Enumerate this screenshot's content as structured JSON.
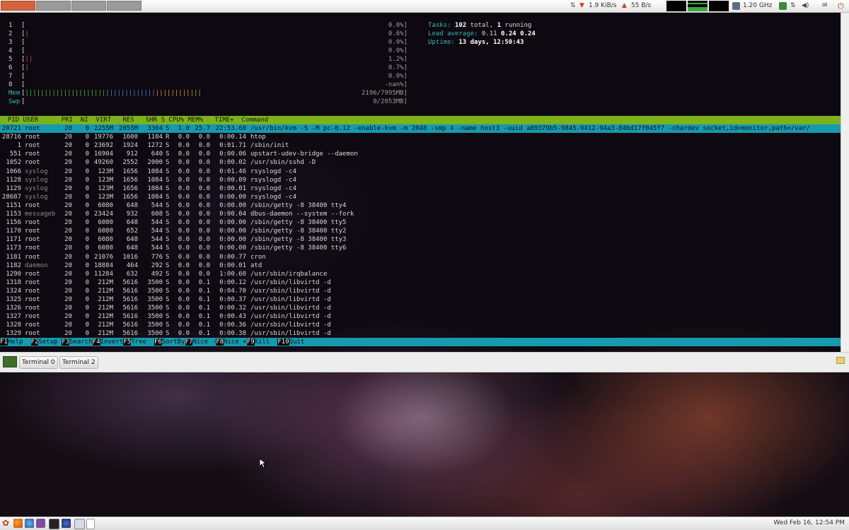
{
  "top_panel": {
    "net_down": "1.9 KiB/s",
    "net_up": "55 B/s",
    "cpu_freq": "1.20 GHz",
    "icons": [
      "network-arrows-icon",
      "download-arrow-icon",
      "upload-arrow-icon",
      "cpu-freq-icon",
      "update-icon",
      "network-icon",
      "volume-icon",
      "mail-icon",
      "power-icon"
    ]
  },
  "htop": {
    "cpus": [
      {
        "label": "1",
        "bar": "",
        "value": "0.0%]"
      },
      {
        "label": "2",
        "bar": "|",
        "value": "0.6%]"
      },
      {
        "label": "3",
        "bar": "",
        "value": "0.0%]"
      },
      {
        "label": "4",
        "bar": "",
        "value": "0.0%]"
      },
      {
        "label": "5",
        "bar": "||",
        "value": "1.2%]"
      },
      {
        "label": "6",
        "bar": "|",
        "value": "0.7%]"
      },
      {
        "label": "7",
        "bar": "",
        "value": "0.0%]"
      },
      {
        "label": "8",
        "bar": "",
        "value": "-nan%]"
      }
    ],
    "mem": {
      "label": "Mem",
      "value": "2196/7995MB]"
    },
    "swp": {
      "label": "Swp",
      "value": "0/2053MB]"
    },
    "tasks_label": "Tasks:",
    "tasks_total": "102",
    "tasks_total_word": "total,",
    "tasks_running": "1",
    "tasks_running_word": "running",
    "load_label": "Load average:",
    "load_1": "0.11",
    "load_5": "0.24",
    "load_15": "0.24",
    "uptime_label": "Uptime:",
    "uptime_value": "13 days, 12:50:43",
    "header": "  PID USER      PRI  NI  VIRT   RES   SHR S CPU% MEM%   TIME+  Command",
    "processes": [
      {
        "pid": "20721",
        "user": "root",
        "pri": "20",
        "ni": "0",
        "virt": "2255M",
        "res": "2055M",
        "shr": "3304",
        "s": "S",
        "cpu": "1.0",
        "mem": "25.7",
        "time": "22:53.68",
        "cmd": "/usr/bin/kvm -S -M pc-0.12 -enable-kvm -m 2048 -smp 4 -name host3 -uuid a89379b5-9845-9412-94a3-846d17f045f7 -chardev socket,id=monitor,path=/var/"
      },
      {
        "pid": "28716",
        "user": "root",
        "pri": "20",
        "ni": "0",
        "virt": "19776",
        "res": "1600",
        "shr": "1104",
        "s": "R",
        "cpu": "0.0",
        "mem": "0.0",
        "time": "0:00.14",
        "cmd": "htop"
      },
      {
        "pid": "1",
        "user": "root",
        "pri": "20",
        "ni": "0",
        "virt": "23692",
        "res": "1924",
        "shr": "1272",
        "s": "S",
        "cpu": "0.0",
        "mem": "0.0",
        "time": "0:01.71",
        "cmd": "/sbin/init"
      },
      {
        "pid": "551",
        "user": "root",
        "pri": "20",
        "ni": "0",
        "virt": "16904",
        "res": "912",
        "shr": "640",
        "s": "S",
        "cpu": "0.0",
        "mem": "0.0",
        "time": "0:00.06",
        "cmd": "upstart-udev-bridge --daemon"
      },
      {
        "pid": "1052",
        "user": "root",
        "pri": "20",
        "ni": "0",
        "virt": "49260",
        "res": "2552",
        "shr": "2000",
        "s": "S",
        "cpu": "0.0",
        "mem": "0.0",
        "time": "0:00.02",
        "cmd": "/usr/sbin/sshd -D"
      },
      {
        "pid": "1066",
        "user": "syslog",
        "pri": "20",
        "ni": "0",
        "virt": "123M",
        "res": "1656",
        "shr": "1084",
        "s": "S",
        "cpu": "0.0",
        "mem": "0.0",
        "time": "0:01.46",
        "cmd": "rsyslogd -c4"
      },
      {
        "pid": "1128",
        "user": "syslog",
        "pri": "20",
        "ni": "0",
        "virt": "123M",
        "res": "1656",
        "shr": "1084",
        "s": "S",
        "cpu": "0.0",
        "mem": "0.0",
        "time": "0:00.09",
        "cmd": "rsyslogd -c4"
      },
      {
        "pid": "1129",
        "user": "syslog",
        "pri": "20",
        "ni": "0",
        "virt": "123M",
        "res": "1656",
        "shr": "1084",
        "s": "S",
        "cpu": "0.0",
        "mem": "0.0",
        "time": "0:00.01",
        "cmd": "rsyslogd -c4"
      },
      {
        "pid": "28687",
        "user": "syslog",
        "pri": "20",
        "ni": "0",
        "virt": "123M",
        "res": "1656",
        "shr": "1084",
        "s": "S",
        "cpu": "0.0",
        "mem": "0.0",
        "time": "0:00.00",
        "cmd": "rsyslogd -c4"
      },
      {
        "pid": "1151",
        "user": "root",
        "pri": "20",
        "ni": "0",
        "virt": "6080",
        "res": "648",
        "shr": "544",
        "s": "S",
        "cpu": "0.0",
        "mem": "0.0",
        "time": "0:00.00",
        "cmd": "/sbin/getty -8 38400 tty4"
      },
      {
        "pid": "1153",
        "user": "messageb",
        "pri": "20",
        "ni": "0",
        "virt": "23424",
        "res": "932",
        "shr": "608",
        "s": "S",
        "cpu": "0.0",
        "mem": "0.0",
        "time": "0:00.04",
        "cmd": "dbus-daemon --system --fork"
      },
      {
        "pid": "1156",
        "user": "root",
        "pri": "20",
        "ni": "0",
        "virt": "6080",
        "res": "648",
        "shr": "544",
        "s": "S",
        "cpu": "0.0",
        "mem": "0.0",
        "time": "0:00.00",
        "cmd": "/sbin/getty -8 38400 tty5"
      },
      {
        "pid": "1170",
        "user": "root",
        "pri": "20",
        "ni": "0",
        "virt": "6080",
        "res": "652",
        "shr": "544",
        "s": "S",
        "cpu": "0.0",
        "mem": "0.0",
        "time": "0:00.00",
        "cmd": "/sbin/getty -8 38400 tty2"
      },
      {
        "pid": "1171",
        "user": "root",
        "pri": "20",
        "ni": "0",
        "virt": "6080",
        "res": "648",
        "shr": "544",
        "s": "S",
        "cpu": "0.0",
        "mem": "0.0",
        "time": "0:00.00",
        "cmd": "/sbin/getty -8 38400 tty3"
      },
      {
        "pid": "1173",
        "user": "root",
        "pri": "20",
        "ni": "0",
        "virt": "6080",
        "res": "648",
        "shr": "544",
        "s": "S",
        "cpu": "0.0",
        "mem": "0.0",
        "time": "0:00.00",
        "cmd": "/sbin/getty -8 38400 tty6"
      },
      {
        "pid": "1181",
        "user": "root",
        "pri": "20",
        "ni": "0",
        "virt": "21076",
        "res": "1016",
        "shr": "776",
        "s": "S",
        "cpu": "0.0",
        "mem": "0.0",
        "time": "0:00.77",
        "cmd": "cron"
      },
      {
        "pid": "1182",
        "user": "daemon",
        "pri": "20",
        "ni": "0",
        "virt": "18884",
        "res": "464",
        "shr": "292",
        "s": "S",
        "cpu": "0.0",
        "mem": "0.0",
        "time": "0:00.01",
        "cmd": "atd"
      },
      {
        "pid": "1290",
        "user": "root",
        "pri": "20",
        "ni": "0",
        "virt": "11284",
        "res": "632",
        "shr": "492",
        "s": "S",
        "cpu": "0.0",
        "mem": "0.0",
        "time": "1:00.60",
        "cmd": "/usr/sbin/irqbalance"
      },
      {
        "pid": "1318",
        "user": "root",
        "pri": "20",
        "ni": "0",
        "virt": "212M",
        "res": "5616",
        "shr": "3500",
        "s": "S",
        "cpu": "0.0",
        "mem": "0.1",
        "time": "0:00.12",
        "cmd": "/usr/sbin/libvirtd -d"
      },
      {
        "pid": "1324",
        "user": "root",
        "pri": "20",
        "ni": "0",
        "virt": "212M",
        "res": "5616",
        "shr": "3500",
        "s": "S",
        "cpu": "0.0",
        "mem": "0.1",
        "time": "0:04.70",
        "cmd": "/usr/sbin/libvirtd -d"
      },
      {
        "pid": "1325",
        "user": "root",
        "pri": "20",
        "ni": "0",
        "virt": "212M",
        "res": "5616",
        "shr": "3500",
        "s": "S",
        "cpu": "0.0",
        "mem": "0.1",
        "time": "0:00.37",
        "cmd": "/usr/sbin/libvirtd -d"
      },
      {
        "pid": "1326",
        "user": "root",
        "pri": "20",
        "ni": "0",
        "virt": "212M",
        "res": "5616",
        "shr": "3500",
        "s": "S",
        "cpu": "0.0",
        "mem": "0.1",
        "time": "0:00.32",
        "cmd": "/usr/sbin/libvirtd -d"
      },
      {
        "pid": "1327",
        "user": "root",
        "pri": "20",
        "ni": "0",
        "virt": "212M",
        "res": "5616",
        "shr": "3500",
        "s": "S",
        "cpu": "0.0",
        "mem": "0.1",
        "time": "0:00.43",
        "cmd": "/usr/sbin/libvirtd -d"
      },
      {
        "pid": "1328",
        "user": "root",
        "pri": "20",
        "ni": "0",
        "virt": "212M",
        "res": "5616",
        "shr": "3500",
        "s": "S",
        "cpu": "0.0",
        "mem": "0.1",
        "time": "0:00.36",
        "cmd": "/usr/sbin/libvirtd -d"
      },
      {
        "pid": "1329",
        "user": "root",
        "pri": "20",
        "ni": "0",
        "virt": "212M",
        "res": "5616",
        "shr": "3500",
        "s": "S",
        "cpu": "0.0",
        "mem": "0.1",
        "time": "0:00.38",
        "cmd": "/usr/sbin/libvirtd -d"
      }
    ],
    "fkeys": [
      {
        "k": "F1",
        "l": "Help  "
      },
      {
        "k": "F2",
        "l": "Setup "
      },
      {
        "k": "F3",
        "l": "Search"
      },
      {
        "k": "F4",
        "l": "Invert"
      },
      {
        "k": "F5",
        "l": "Tree  "
      },
      {
        "k": "F6",
        "l": "SortBy"
      },
      {
        "k": "F7",
        "l": "Nice -"
      },
      {
        "k": "F8",
        "l": "Nice +"
      },
      {
        "k": "F9",
        "l": "Kill  "
      },
      {
        "k": "F10",
        "l": "Quit"
      }
    ]
  },
  "tabs": {
    "items": [
      "Terminal 0",
      "Terminal 2"
    ]
  },
  "bottom_panel": {
    "clock": "Wed Feb 16, 12:54 PM"
  },
  "colors": {
    "header_bar": "#7db21c",
    "selection": "#159ab0",
    "accent_cyan": "#2bb8b8"
  }
}
